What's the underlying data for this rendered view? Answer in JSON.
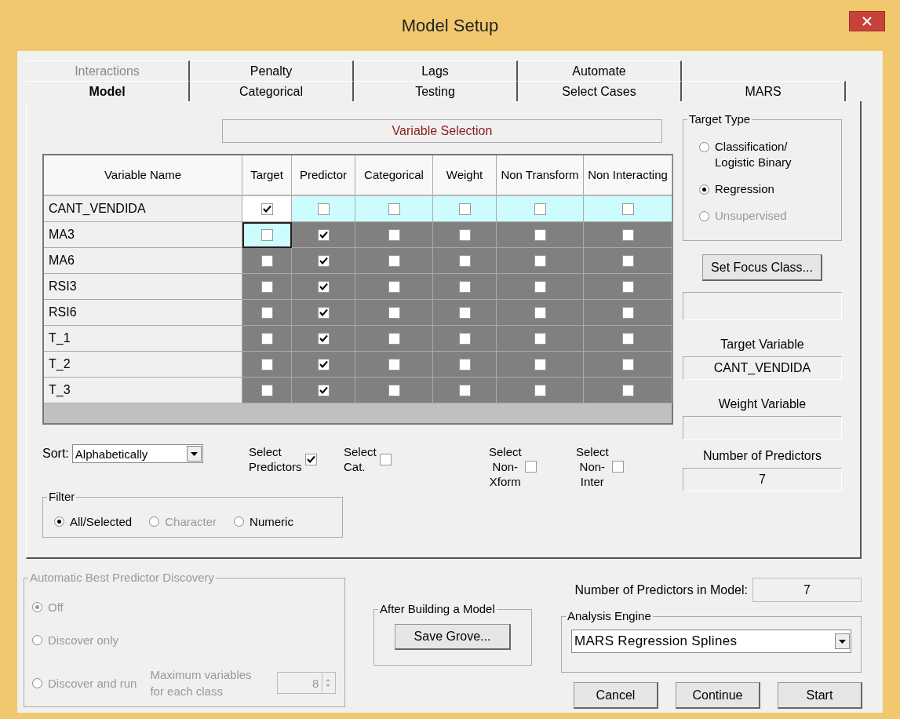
{
  "window": {
    "title": "Model Setup"
  },
  "tabs_back": [
    {
      "label": "Interactions",
      "selected": false,
      "disabled": true
    },
    {
      "label": "Penalty",
      "selected": false,
      "disabled": false
    },
    {
      "label": "Lags",
      "selected": false,
      "disabled": false
    },
    {
      "label": "Automate",
      "selected": false,
      "disabled": false
    }
  ],
  "tabs_front": [
    {
      "label": "Model",
      "selected": true,
      "disabled": false
    },
    {
      "label": "Categorical",
      "selected": false,
      "disabled": false
    },
    {
      "label": "Testing",
      "selected": false,
      "disabled": false
    },
    {
      "label": "Select Cases",
      "selected": false,
      "disabled": false
    },
    {
      "label": "MARS",
      "selected": false,
      "disabled": false
    }
  ],
  "section_title": "Variable Selection",
  "table": {
    "columns": [
      "Variable Name",
      "Target",
      "Predictor",
      "Categorical",
      "Weight",
      "Non Transform",
      "Non Interacting"
    ],
    "rows": [
      {
        "name": "CANT_VENDIDA",
        "selected": true,
        "focused": false,
        "checks": [
          true,
          false,
          false,
          false,
          false,
          false
        ]
      },
      {
        "name": "MA3",
        "selected": false,
        "focused": true,
        "checks": [
          false,
          true,
          false,
          false,
          false,
          false
        ]
      },
      {
        "name": "MA6",
        "selected": false,
        "focused": false,
        "checks": [
          false,
          true,
          false,
          false,
          false,
          false
        ]
      },
      {
        "name": "RSI3",
        "selected": false,
        "focused": false,
        "checks": [
          false,
          true,
          false,
          false,
          false,
          false
        ]
      },
      {
        "name": "RSI6",
        "selected": false,
        "focused": false,
        "checks": [
          false,
          true,
          false,
          false,
          false,
          false
        ]
      },
      {
        "name": "T_1",
        "selected": false,
        "focused": false,
        "checks": [
          false,
          true,
          false,
          false,
          false,
          false
        ]
      },
      {
        "name": "T_2",
        "selected": false,
        "focused": false,
        "checks": [
          false,
          true,
          false,
          false,
          false,
          false
        ]
      },
      {
        "name": "T_3",
        "selected": false,
        "focused": false,
        "checks": [
          false,
          true,
          false,
          false,
          false,
          false
        ]
      }
    ]
  },
  "sort": {
    "label": "Sort:",
    "value": "Alphabetically"
  },
  "select_options": [
    {
      "label": "Select Predictors",
      "checked": true
    },
    {
      "label": "Select Cat.",
      "checked": false
    },
    {
      "label": "Select Non-Xform",
      "checked": false
    },
    {
      "label": "Select Non-Inter",
      "checked": false
    }
  ],
  "filter": {
    "title": "Filter",
    "options": [
      {
        "label": "All/Selected",
        "selected": true,
        "disabled": false
      },
      {
        "label": "Character",
        "selected": false,
        "disabled": true
      },
      {
        "label": "Numeric",
        "selected": false,
        "disabled": false
      }
    ]
  },
  "target_type": {
    "title": "Target Type",
    "options": [
      {
        "label": "Classification/ Logistic Binary",
        "selected": false,
        "disabled": false
      },
      {
        "label": "Regression",
        "selected": true,
        "disabled": false
      },
      {
        "label": "Unsupervised",
        "selected": false,
        "disabled": true
      }
    ]
  },
  "focus_button": "Set Focus Class...",
  "target_variable": {
    "label": "Target Variable",
    "value": "CANT_VENDIDA"
  },
  "weight_variable": {
    "label": "Weight Variable"
  },
  "number_of_predictors": {
    "label": "Number of Predictors",
    "value": "7"
  },
  "discovery": {
    "title": "Automatic Best Predictor Discovery",
    "disabled": true,
    "options": [
      {
        "label": "Off",
        "selected": true
      },
      {
        "label": "Discover only",
        "selected": false
      },
      {
        "label": "Discover and run",
        "selected": false
      }
    ],
    "max_label": "Maximum variables for each class",
    "max_value": "8"
  },
  "after_build": {
    "title": "After Building a Model",
    "button": "Save Grove..."
  },
  "predictors_in_model": {
    "label": "Number of Predictors in Model:",
    "value": "7"
  },
  "engine": {
    "title": "Analysis Engine",
    "value": "MARS Regression Splines"
  },
  "buttons": [
    "Cancel",
    "Continue",
    "Start"
  ]
}
